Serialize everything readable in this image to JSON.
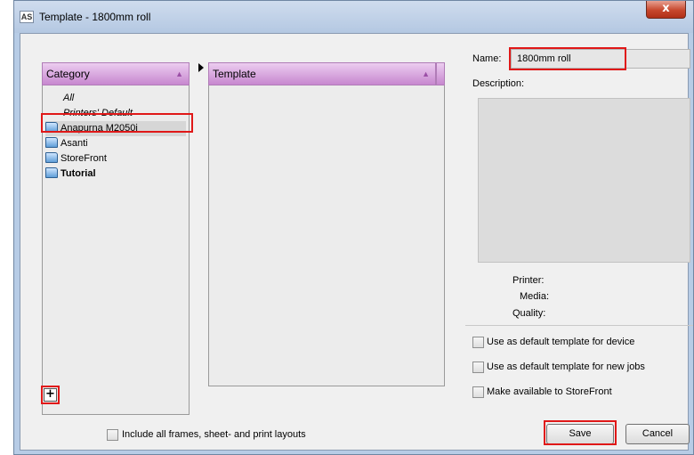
{
  "window": {
    "app_icon_text": "AS",
    "title": "Template - 1800mm roll",
    "close_glyph": "x"
  },
  "category_panel": {
    "header": "Category",
    "items": [
      {
        "label": "All",
        "style": "italic",
        "icon": "none"
      },
      {
        "label": "Printers' Default",
        "style": "italic",
        "icon": "none"
      },
      {
        "label": "Anapurna M2050i",
        "style": "normal",
        "icon": "folder-icon",
        "selected": true
      },
      {
        "label": "Asanti",
        "style": "normal",
        "icon": "folder-icon"
      },
      {
        "label": "StoreFront",
        "style": "normal",
        "icon": "folder-icon"
      },
      {
        "label": "Tutorial",
        "style": "bold",
        "icon": "folder-icon"
      }
    ],
    "add_glyph": "+"
  },
  "template_panel": {
    "header": "Template"
  },
  "details": {
    "name_label": "Name:",
    "name_value": "1800mm roll",
    "description_label": "Description:",
    "printer_label": "Printer:",
    "media_label": "Media:",
    "quality_label": "Quality:"
  },
  "options": {
    "default_device": "Use as default template for device",
    "default_new_jobs": "Use as default template for new jobs",
    "storefront": "Make available to StoreFront",
    "include_all": "Include all frames, sheet- and print layouts"
  },
  "buttons": {
    "save": "Save",
    "cancel": "Cancel"
  },
  "colors": {
    "header_gradient_top": "#eccdf0",
    "header_gradient_bottom": "#c787cf",
    "highlight_red": "#e01818"
  }
}
